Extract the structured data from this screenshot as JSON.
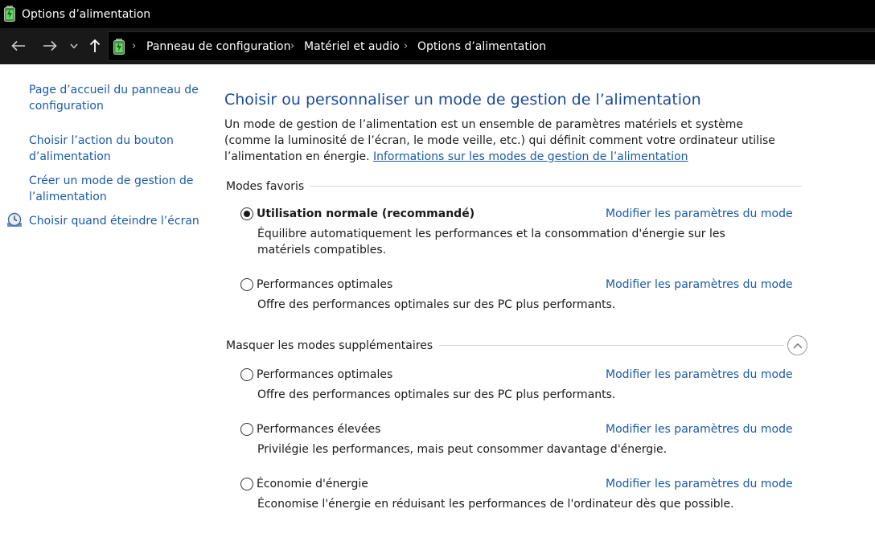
{
  "window": {
    "title": "Options d’alimentation",
    "icon": "battery-icon"
  },
  "nav": {
    "back_icon": "back-arrow-icon",
    "forward_icon": "forward-arrow-icon",
    "recent_icon": "chevron-down-icon",
    "up_icon": "up-arrow-icon",
    "breadcrumbs": [
      "Panneau de configuration",
      "Matériel et audio",
      "Options d’alimentation"
    ]
  },
  "sidebar": {
    "links": [
      "Page d’accueil du panneau de configuration",
      "Choisir l’action du bouton d’alimentation",
      "Créer un mode de gestion de l’alimentation",
      "Choisir quand éteindre l’écran"
    ],
    "screen_icon": "clock-monitor-icon"
  },
  "main": {
    "heading": "Choisir ou personnaliser un mode de gestion de l’alimentation",
    "description": "Un mode de gestion de l’alimentation est un ensemble de paramètres matériels et système (comme la luminosité de l’écran, le mode veille, etc.) qui définit comment votre ordinateur utilise l’alimentation en énergie. ",
    "info_link": "Informations sur les modes de gestion de l’alimentation",
    "favorites_label": "Modes favoris",
    "extra_label": "Masquer les modes supplémentaires",
    "modify_label": "Modifier les paramètres du mode",
    "favorite_plans": [
      {
        "name": "Utilisation normale (recommandé)",
        "desc": "Équilibre automatiquement les performances et la consommation d'énergie sur les matériels compatibles.",
        "selected": true
      },
      {
        "name": "Performances optimales",
        "desc": "Offre des performances optimales sur des PC plus performants.",
        "selected": false
      }
    ],
    "extra_plans": [
      {
        "name": "Performances optimales",
        "desc": "Offre des performances optimales sur des PC plus performants.",
        "selected": false
      },
      {
        "name": "Performances élevées",
        "desc": "Privilégie les performances, mais peut consommer davantage d'énergie.",
        "selected": false
      },
      {
        "name": "Économie d'énergie",
        "desc": "Économise l'énergie en réduisant les performances de l'ordinateur dès que possible.",
        "selected": false
      }
    ]
  },
  "colors": {
    "link": "#1a5aa8",
    "heading": "#1a4a96",
    "titlebar": "#000000",
    "navbar": "#191919"
  }
}
